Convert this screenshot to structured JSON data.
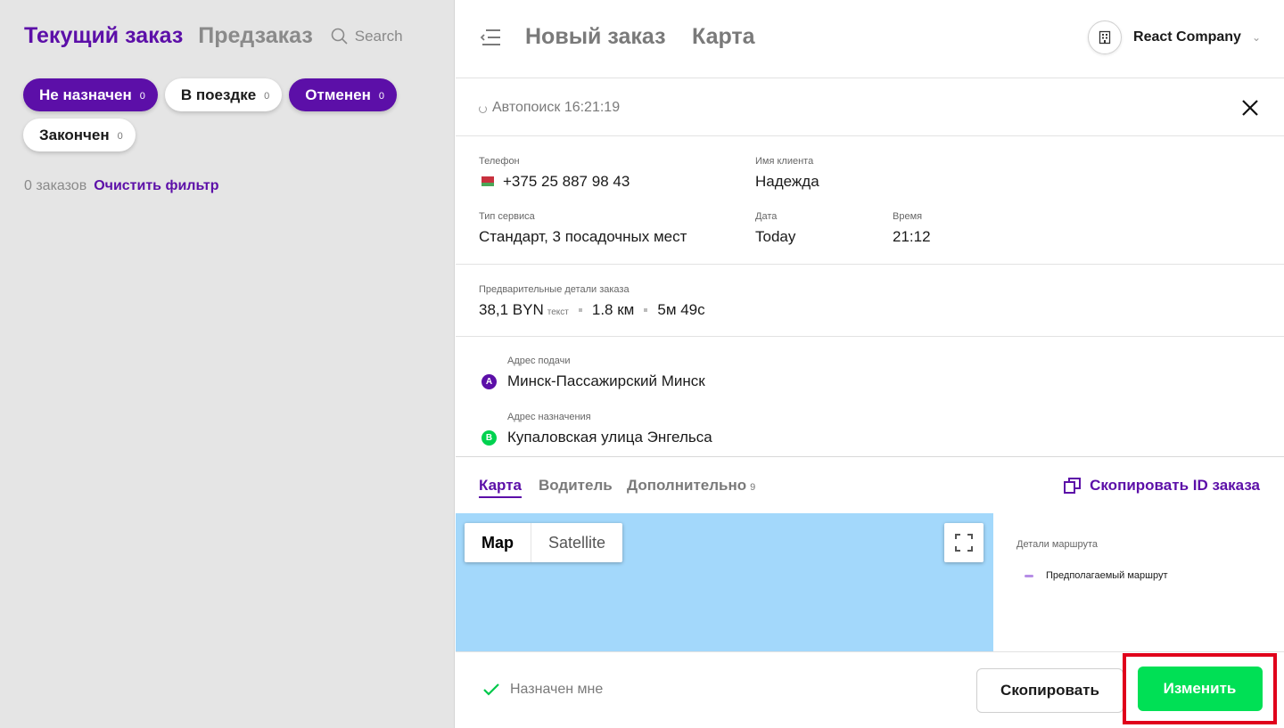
{
  "left": {
    "tab_current": "Текущий заказ",
    "tab_preorder": "Предзаказ",
    "search_label": "Search",
    "chips": [
      {
        "label": "Не назначен",
        "count": "0"
      },
      {
        "label": "В поездке",
        "count": "0"
      },
      {
        "label": "Отменен",
        "count": "0"
      },
      {
        "label": "Закончен",
        "count": "0"
      }
    ],
    "orders_count": "0 заказов",
    "clear_filter": "Очистить фильтр"
  },
  "header": {
    "title": "Новый заказ",
    "map_title": "Карта",
    "company": "React Company"
  },
  "autosearch": {
    "text": "Автопоиск 16:21:19"
  },
  "info": {
    "phone_label": "Телефон",
    "phone": "+375 25 887 98 43",
    "client_label": "Имя клиента",
    "client": "Надежда",
    "service_label": "Тип сервиса",
    "service": "Стандарт, 3 посадочных мест",
    "date_label": "Дата",
    "date": "Today",
    "time_label": "Время",
    "time": "21:12"
  },
  "details": {
    "label": "Предварительные детали заказа",
    "price": "38,1 BYN",
    "price_note": "текст",
    "distance": "1.8 км",
    "duration": "5м 49с"
  },
  "addresses": {
    "pickup_label": "Адрес подачи",
    "pickup_badge": "A",
    "pickup": "Минск-Пассажирский Минск",
    "dest_label": "Адрес назначения",
    "dest_badge": "B",
    "dest": "Купаловская улица Энгельса"
  },
  "tabs": {
    "map": "Карта",
    "driver": "Водитель",
    "extra": "Дополнительно",
    "extra_count": "9",
    "copy_id": "Скопировать ID заказа"
  },
  "map": {
    "map_btn": "Map",
    "satellite_btn": "Satellite"
  },
  "route": {
    "title": "Детали маршрута",
    "legend": "Предполагаемый маршрут"
  },
  "footer": {
    "assigned": "Назначен мне",
    "copy_btn": "Скопировать",
    "edit_btn": "Изменить"
  },
  "colors": {
    "accent": "#5c0fa8",
    "success": "#00e055",
    "highlight": "#e0001b",
    "map_water": "#a3d8fb"
  }
}
